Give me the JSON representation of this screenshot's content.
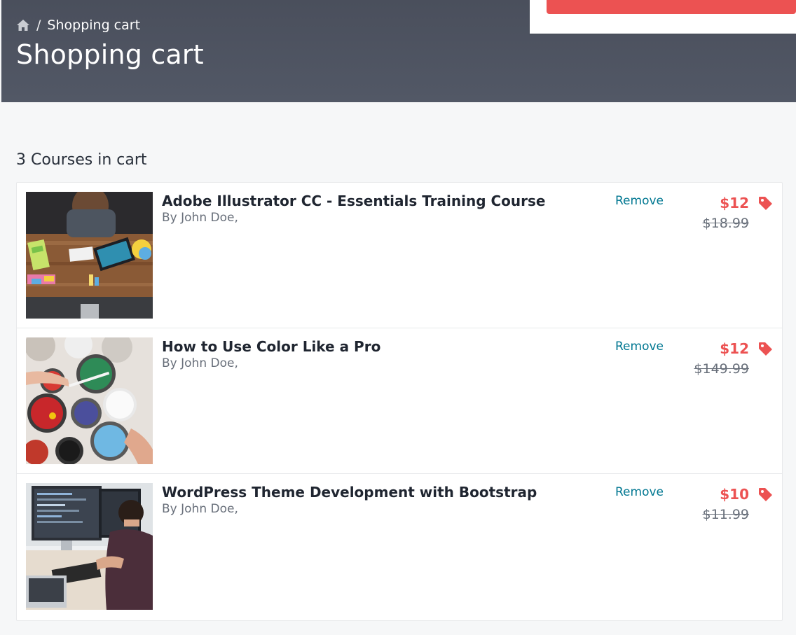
{
  "breadcrumb": {
    "icon": "home-icon",
    "current": "Shopping cart"
  },
  "page": {
    "title": "Shopping cart"
  },
  "cart": {
    "count_label": "3 Courses in cart",
    "items": [
      {
        "title": "Adobe Illustrator CC - Essentials Training Course",
        "author": "By John Doe,",
        "remove_label": "Remove",
        "price": "$12",
        "old_price": "$18.99",
        "tag_icon": "price-tag-icon"
      },
      {
        "title": "How to Use Color Like a Pro",
        "author": "By John Doe,",
        "remove_label": "Remove",
        "price": "$12",
        "old_price": "$149.99",
        "tag_icon": "price-tag-icon"
      },
      {
        "title": "WordPress Theme Development with Bootstrap",
        "author": "By John Doe,",
        "remove_label": "Remove",
        "price": "$10",
        "old_price": "$11.99",
        "tag_icon": "price-tag-icon"
      }
    ]
  },
  "colors": {
    "header": "#4f5563",
    "accent": "#ec5252",
    "link": "#007791",
    "text": "#29303b"
  }
}
